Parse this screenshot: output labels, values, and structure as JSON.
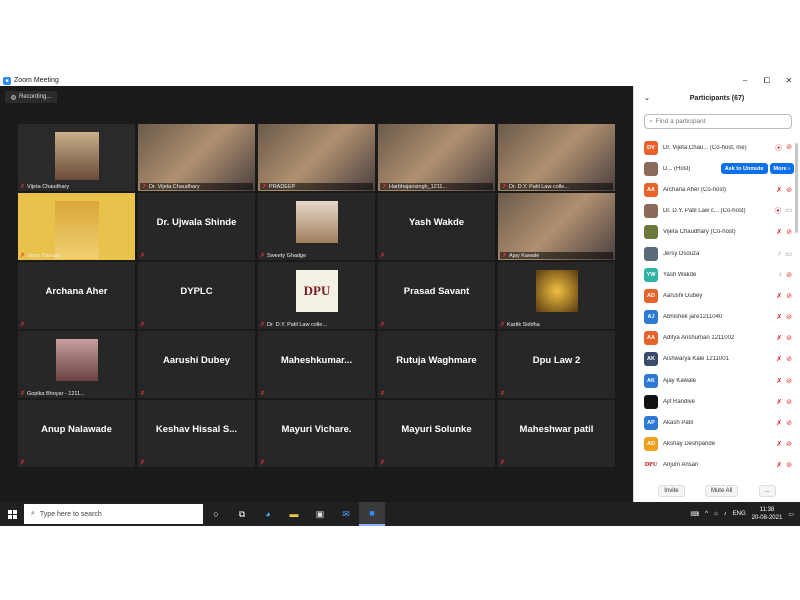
{
  "window": {
    "title": "Zoom Meeting",
    "minimize": "–",
    "maximize": "⧠",
    "close": "✕"
  },
  "recording": {
    "label": "Recording..."
  },
  "tiles": [
    {
      "caption": "Vijeta Chaudhary",
      "name": "",
      "kind": "video-small"
    },
    {
      "caption": "Dr. Vijeta.Chaudhary",
      "name": "",
      "kind": "video"
    },
    {
      "caption": "PRADEEP",
      "name": "",
      "kind": "video"
    },
    {
      "caption": "Harbhajansingh_1211...",
      "name": "",
      "kind": "video"
    },
    {
      "caption": "Dr. D.Y. Patil Law colle...",
      "name": "",
      "kind": "video"
    },
    {
      "caption": "Jersy Dsouza",
      "name": "",
      "kind": "video-small",
      "active": true
    },
    {
      "caption": "",
      "name": "Dr. Ujwala Shinde",
      "kind": "name"
    },
    {
      "caption": "Sweety Ghadge",
      "name": "",
      "kind": "image"
    },
    {
      "caption": "",
      "name": "Yash Wakde",
      "kind": "name"
    },
    {
      "caption": "Ajay Kawale",
      "name": "",
      "kind": "video"
    },
    {
      "caption": "",
      "name": "Archana Aher",
      "kind": "name"
    },
    {
      "caption": "",
      "name": "DYPLC",
      "kind": "name"
    },
    {
      "caption": "Dr. D.Y. Patil Law colle...",
      "name": "",
      "kind": "logo"
    },
    {
      "caption": "",
      "name": "Prasad Savant",
      "kind": "name"
    },
    {
      "caption": "Kartik Siddha",
      "name": "",
      "kind": "image"
    },
    {
      "caption": "Gopika Bhoyar - 1211...",
      "name": "",
      "kind": "image"
    },
    {
      "caption": "",
      "name": "Aarushi Dubey",
      "kind": "name"
    },
    {
      "caption": "",
      "name": "Maheshkumar...",
      "kind": "name"
    },
    {
      "caption": "",
      "name": "Rutuja Waghmare",
      "kind": "name"
    },
    {
      "caption": "",
      "name": "Dpu Law 2",
      "kind": "name"
    },
    {
      "caption": "",
      "name": "Anup Nalawade",
      "kind": "name"
    },
    {
      "caption": "",
      "name": "Keshav  Hissal  S...",
      "kind": "name"
    },
    {
      "caption": "",
      "name": "Mayuri Vichare.",
      "kind": "name"
    },
    {
      "caption": "",
      "name": "Mayuri Solunke",
      "kind": "name"
    },
    {
      "caption": "",
      "name": "Maheshwar patil",
      "kind": "name"
    }
  ],
  "panel": {
    "title": "Participants (67)",
    "search_placeholder": "Find a participant",
    "participants": [
      {
        "initials": "DV",
        "color": "#e8632b",
        "name": "Dr. Vijeta.Chau... (Co-host, me)",
        "mic": "on",
        "cam": "off"
      },
      {
        "initials": "",
        "color": "#8a6b5a",
        "name": "D... (Host)",
        "buttons": [
          "Ask to Unmute",
          "More ›"
        ]
      },
      {
        "initials": "AA",
        "color": "#e8632b",
        "name": "Archana Aher (Co-host)",
        "mic": "off",
        "cam": "off"
      },
      {
        "initials": "",
        "color": "#8a6b5a",
        "name": "Dr. D.Y. Patil Law c... (Co-host)",
        "mic": "on",
        "cam": "on"
      },
      {
        "initials": "",
        "color": "#6b7a3a",
        "name": "Vijeta Chaudhary (Co-host)",
        "mic": "off",
        "cam": "off"
      },
      {
        "initials": "",
        "color": "#5a6a7a",
        "name": "Jersy Dsouza",
        "mic": "muted",
        "cam": "on"
      },
      {
        "initials": "YW",
        "color": "#2fb3a3",
        "name": "Yash Wakde",
        "mic": "muted",
        "cam": "off"
      },
      {
        "initials": "AD",
        "color": "#e8632b",
        "name": "Aarushi Dubey",
        "mic": "off",
        "cam": "off"
      },
      {
        "initials": "AJ",
        "color": "#2d7ad6",
        "name": "Abhishek jare1211040",
        "mic": "off",
        "cam": "off"
      },
      {
        "initials": "AA",
        "color": "#e8632b",
        "name": "Aditya Anshuman 1211002",
        "mic": "off",
        "cam": "off"
      },
      {
        "initials": "AK",
        "color": "#3a4a6a",
        "name": "Aishwarya Kale 1211001",
        "mic": "off",
        "cam": "off"
      },
      {
        "initials": "AK",
        "color": "#2d7ad6",
        "name": "Ajay Kawale",
        "mic": "off",
        "cam": "off"
      },
      {
        "initials": "",
        "color": "#111111",
        "name": "Ajit Randive",
        "mic": "off",
        "cam": "off"
      },
      {
        "initials": "AP",
        "color": "#2d7ad6",
        "name": "Akash Patil",
        "mic": "off",
        "cam": "off"
      },
      {
        "initials": "AD",
        "color": "#f0a020",
        "name": "Akshay Deshpande",
        "mic": "off",
        "cam": "off"
      },
      {
        "initials": "DPU",
        "color": "#ffffff",
        "name": "Anjum Ansari",
        "mic": "off",
        "cam": "off",
        "logo": true
      }
    ],
    "invite": "Invite",
    "mute_all": "Mute All",
    "more": "..."
  },
  "taskbar": {
    "search_placeholder": "Type here to search",
    "lang": "ENG",
    "time": "11:38",
    "date": "20-08-2021"
  }
}
